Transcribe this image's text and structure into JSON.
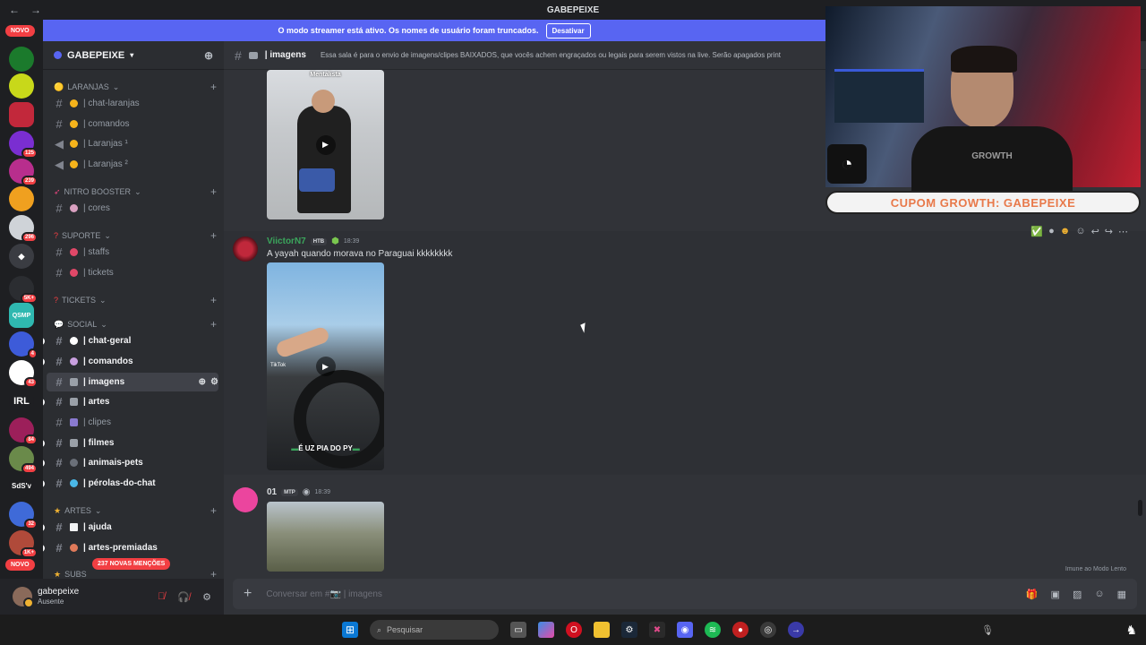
{
  "window": {
    "title": "GABEPEIXE"
  },
  "banner": {
    "text": "O modo streamer está ativo. Os nomes de usuário foram truncados.",
    "button": "Desativar"
  },
  "servers": {
    "novo_top": "NOVO",
    "novo_bottom": "NOVO",
    "badges": [
      "125",
      "239",
      "296",
      "5K+",
      "4",
      "43",
      "84",
      "494",
      "32",
      "1K+"
    ],
    "labels": {
      "irl": "IRL",
      "sds": "SdS'v",
      "gsmp": "QSMP"
    }
  },
  "guild": {
    "name": "GABEPEIXE"
  },
  "categories": {
    "laranjas": "LARANJAS",
    "nitro": "NITRO BOOSTER",
    "suporte": "SUPORTE",
    "tickets": "TICKETS",
    "social": "SOCIAL",
    "artes": "ARTES",
    "subs": "SUBS"
  },
  "channels": {
    "chat_laranjas": "| chat-laranjas",
    "comandos1": "| comandos",
    "laranjas1": "| Laranjas ¹",
    "laranjas2": "| Laranjas ²",
    "cores": "| cores",
    "staffs": "| staffs",
    "tickets": "| tickets",
    "chat_geral": "| chat-geral",
    "comandos2": "| comandos",
    "imagens": "| imagens",
    "artes": "| artes",
    "clipes": "| clipes",
    "filmes": "| filmes",
    "animais": "| animais-pets",
    "perolas": "| pérolas-do-chat",
    "ajuda": "| ajuda",
    "artes_premiadas": "| artes-premiadas"
  },
  "mentions": "237 NOVAS MENÇÕES",
  "user": {
    "name": "gabepeixe",
    "status": "Ausente"
  },
  "header": {
    "channel": "| imagens",
    "topic": "Essa sala é para o envio de imagens/clipes BAIXADOS, que vocês achem engraçados ou legais para serem vistos na live. Serão apagados print"
  },
  "messages": [
    {
      "overlay": "Mentalista"
    },
    {
      "author": "ViictorN7",
      "tag": "HTB",
      "time": "18:39",
      "text": "A yayah quando morava no Paraguai kkkkkkkk",
      "caption": "É UZ PIA DO PY",
      "watermark": "TikTok"
    },
    {
      "author": "01",
      "tag": "MTP",
      "time": "18:39"
    }
  ],
  "immune": "Imune ao Modo Lento",
  "composer": {
    "placeholder": "Conversar em #📷 | imagens"
  },
  "taskbar": {
    "search": "Pesquisar"
  },
  "webcam": {
    "coupon": "CUPOM GROWTH: GABEPEIXE",
    "shirt": "GROWTH"
  }
}
